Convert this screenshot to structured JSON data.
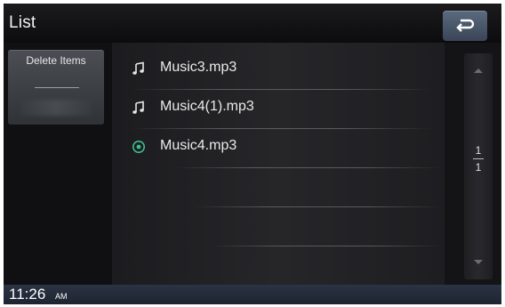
{
  "header": {
    "title": "List",
    "back_icon": "back-arrow-icon"
  },
  "left_panel": {
    "delete_label": "Delete Items"
  },
  "list": {
    "items": [
      {
        "label": "Music3.mp3",
        "icon": "music-note-icon",
        "playing": false
      },
      {
        "label": "Music4(1).mp3",
        "icon": "music-note-icon",
        "playing": false
      },
      {
        "label": "Music4.mp3",
        "icon": "now-playing-icon",
        "playing": true
      }
    ]
  },
  "scrollbar": {
    "current_page": "1",
    "total_pages": "1"
  },
  "status": {
    "time": "11:26",
    "ampm": "AM"
  },
  "colors": {
    "accent": "#3fbf8f",
    "back_button": "#4a5568"
  }
}
